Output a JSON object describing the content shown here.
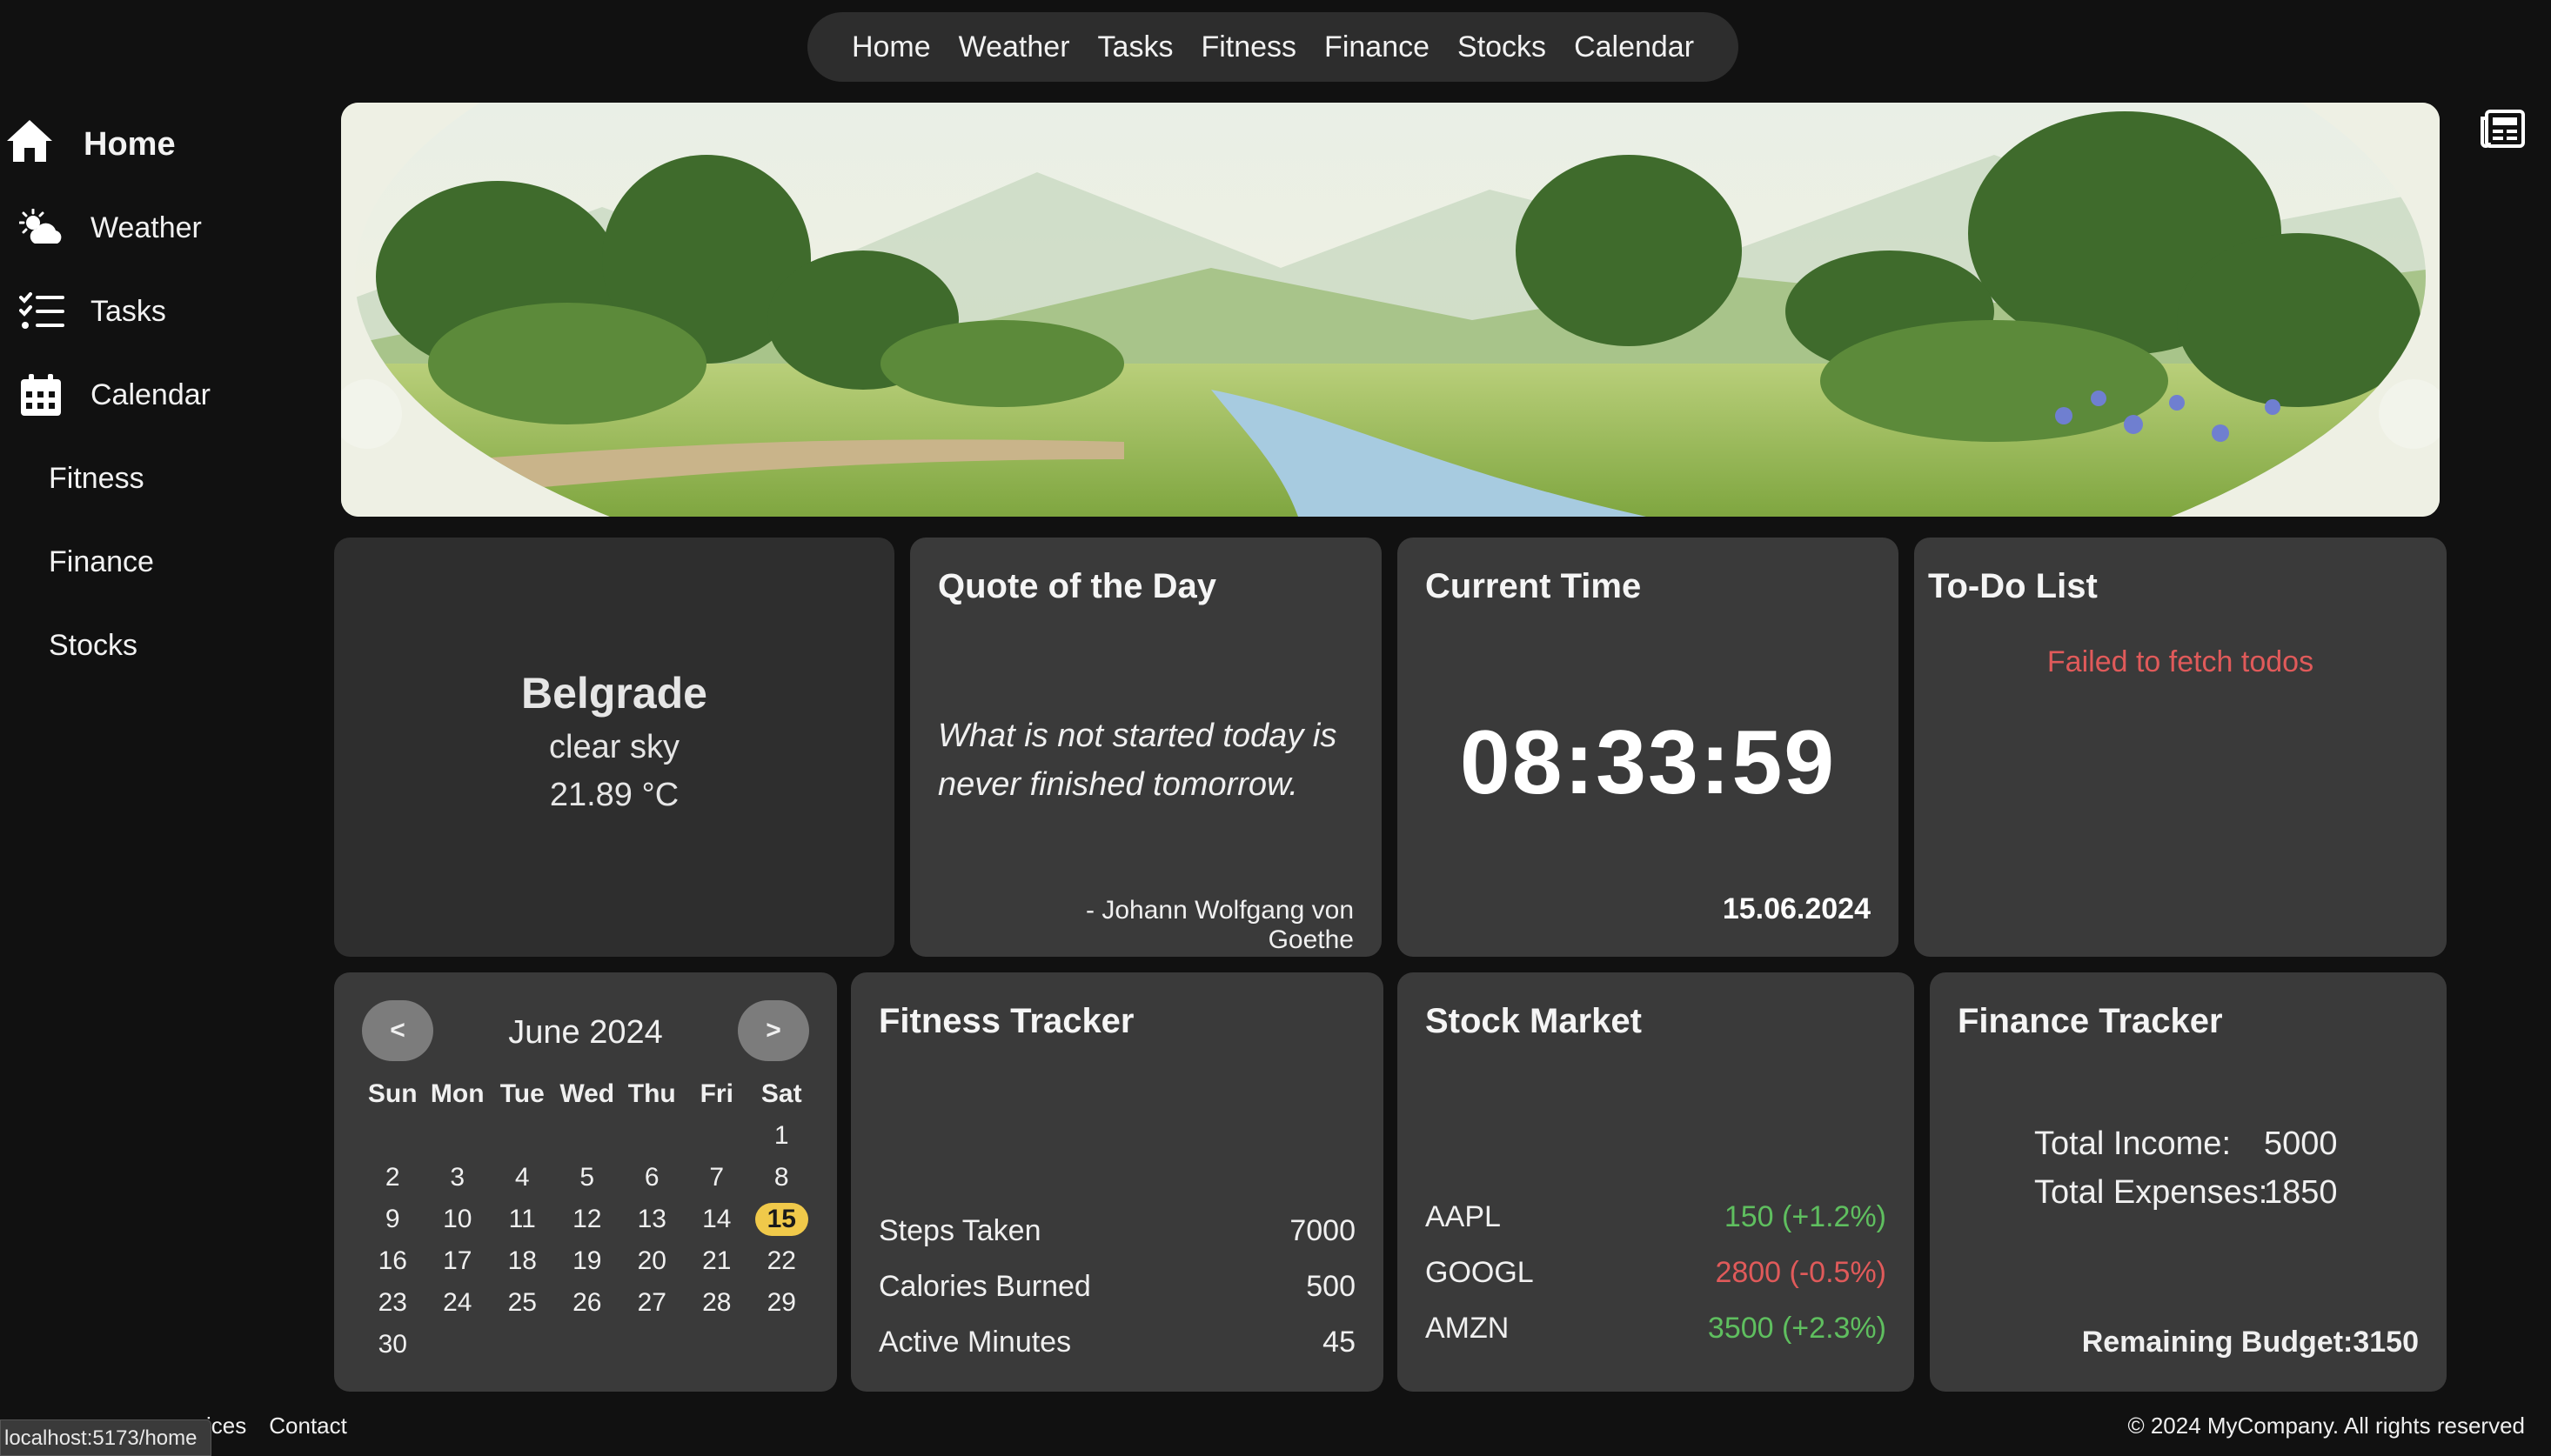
{
  "topnav": {
    "items": [
      "Home",
      "Weather",
      "Tasks",
      "Fitness",
      "Finance",
      "Stocks",
      "Calendar"
    ]
  },
  "sidebar": {
    "items": [
      {
        "label": "Home",
        "icon": "home-icon"
      },
      {
        "label": "Weather",
        "icon": "weather-icon"
      },
      {
        "label": "Tasks",
        "icon": "tasks-icon"
      },
      {
        "label": "Calendar",
        "icon": "calendar-icon"
      },
      {
        "label": "Fitness",
        "icon": ""
      },
      {
        "label": "Finance",
        "icon": ""
      },
      {
        "label": "Stocks",
        "icon": ""
      }
    ]
  },
  "weather": {
    "city": "Belgrade",
    "description": "clear sky",
    "temperature": "21.89 °C"
  },
  "quote": {
    "title": "Quote of the Day",
    "text": "What is not started today is never finished tomorrow.",
    "author": "- Johann Wolfgang von Goethe"
  },
  "time": {
    "title": "Current Time",
    "value": "08:33:59",
    "date": "15.06.2024"
  },
  "todo": {
    "title": "To-Do List",
    "error": "Failed to fetch todos"
  },
  "calendar": {
    "month": "June 2024",
    "prev_label": "<",
    "next_label": ">",
    "weekdays": [
      "Sun",
      "Mon",
      "Tue",
      "Wed",
      "Thu",
      "Fri",
      "Sat"
    ],
    "weeks": [
      [
        "",
        "",
        "",
        "",
        "",
        "",
        "1"
      ],
      [
        "2",
        "3",
        "4",
        "5",
        "6",
        "7",
        "8"
      ],
      [
        "9",
        "10",
        "11",
        "12",
        "13",
        "14",
        "15"
      ],
      [
        "16",
        "17",
        "18",
        "19",
        "20",
        "21",
        "22"
      ],
      [
        "23",
        "24",
        "25",
        "26",
        "27",
        "28",
        "29"
      ],
      [
        "30",
        "",
        "",
        "",
        "",
        "",
        ""
      ]
    ],
    "today": "15"
  },
  "fitness": {
    "title": "Fitness Tracker",
    "rows": [
      {
        "label": "Steps Taken",
        "value": "7000"
      },
      {
        "label": "Calories Burned",
        "value": "500"
      },
      {
        "label": "Active Minutes",
        "value": "45"
      }
    ]
  },
  "stocks": {
    "title": "Stock Market",
    "rows": [
      {
        "symbol": "AAPL",
        "value": "150 (+1.2%)",
        "trend": "up"
      },
      {
        "symbol": "GOOGL",
        "value": "2800 (-0.5%)",
        "trend": "down"
      },
      {
        "symbol": "AMZN",
        "value": "3500 (+2.3%)",
        "trend": "up"
      }
    ]
  },
  "finance": {
    "title": "Finance Tracker",
    "income_label": "Total Income:",
    "income_value": "5000",
    "expenses_label": "Total Expenses:",
    "expenses_value": "1850",
    "budget": "Remaining Budget:3150"
  },
  "footer": {
    "links": [
      "vices",
      "Contact"
    ],
    "copyright": "© 2024 MyCompany. All rights reserved"
  },
  "status_url": "localhost:5173/home",
  "colors": {
    "background": "#111111",
    "card": "#3a3a3a",
    "up": "#5fbf5f",
    "down": "#e05a5a",
    "today": "#f0c94a"
  }
}
